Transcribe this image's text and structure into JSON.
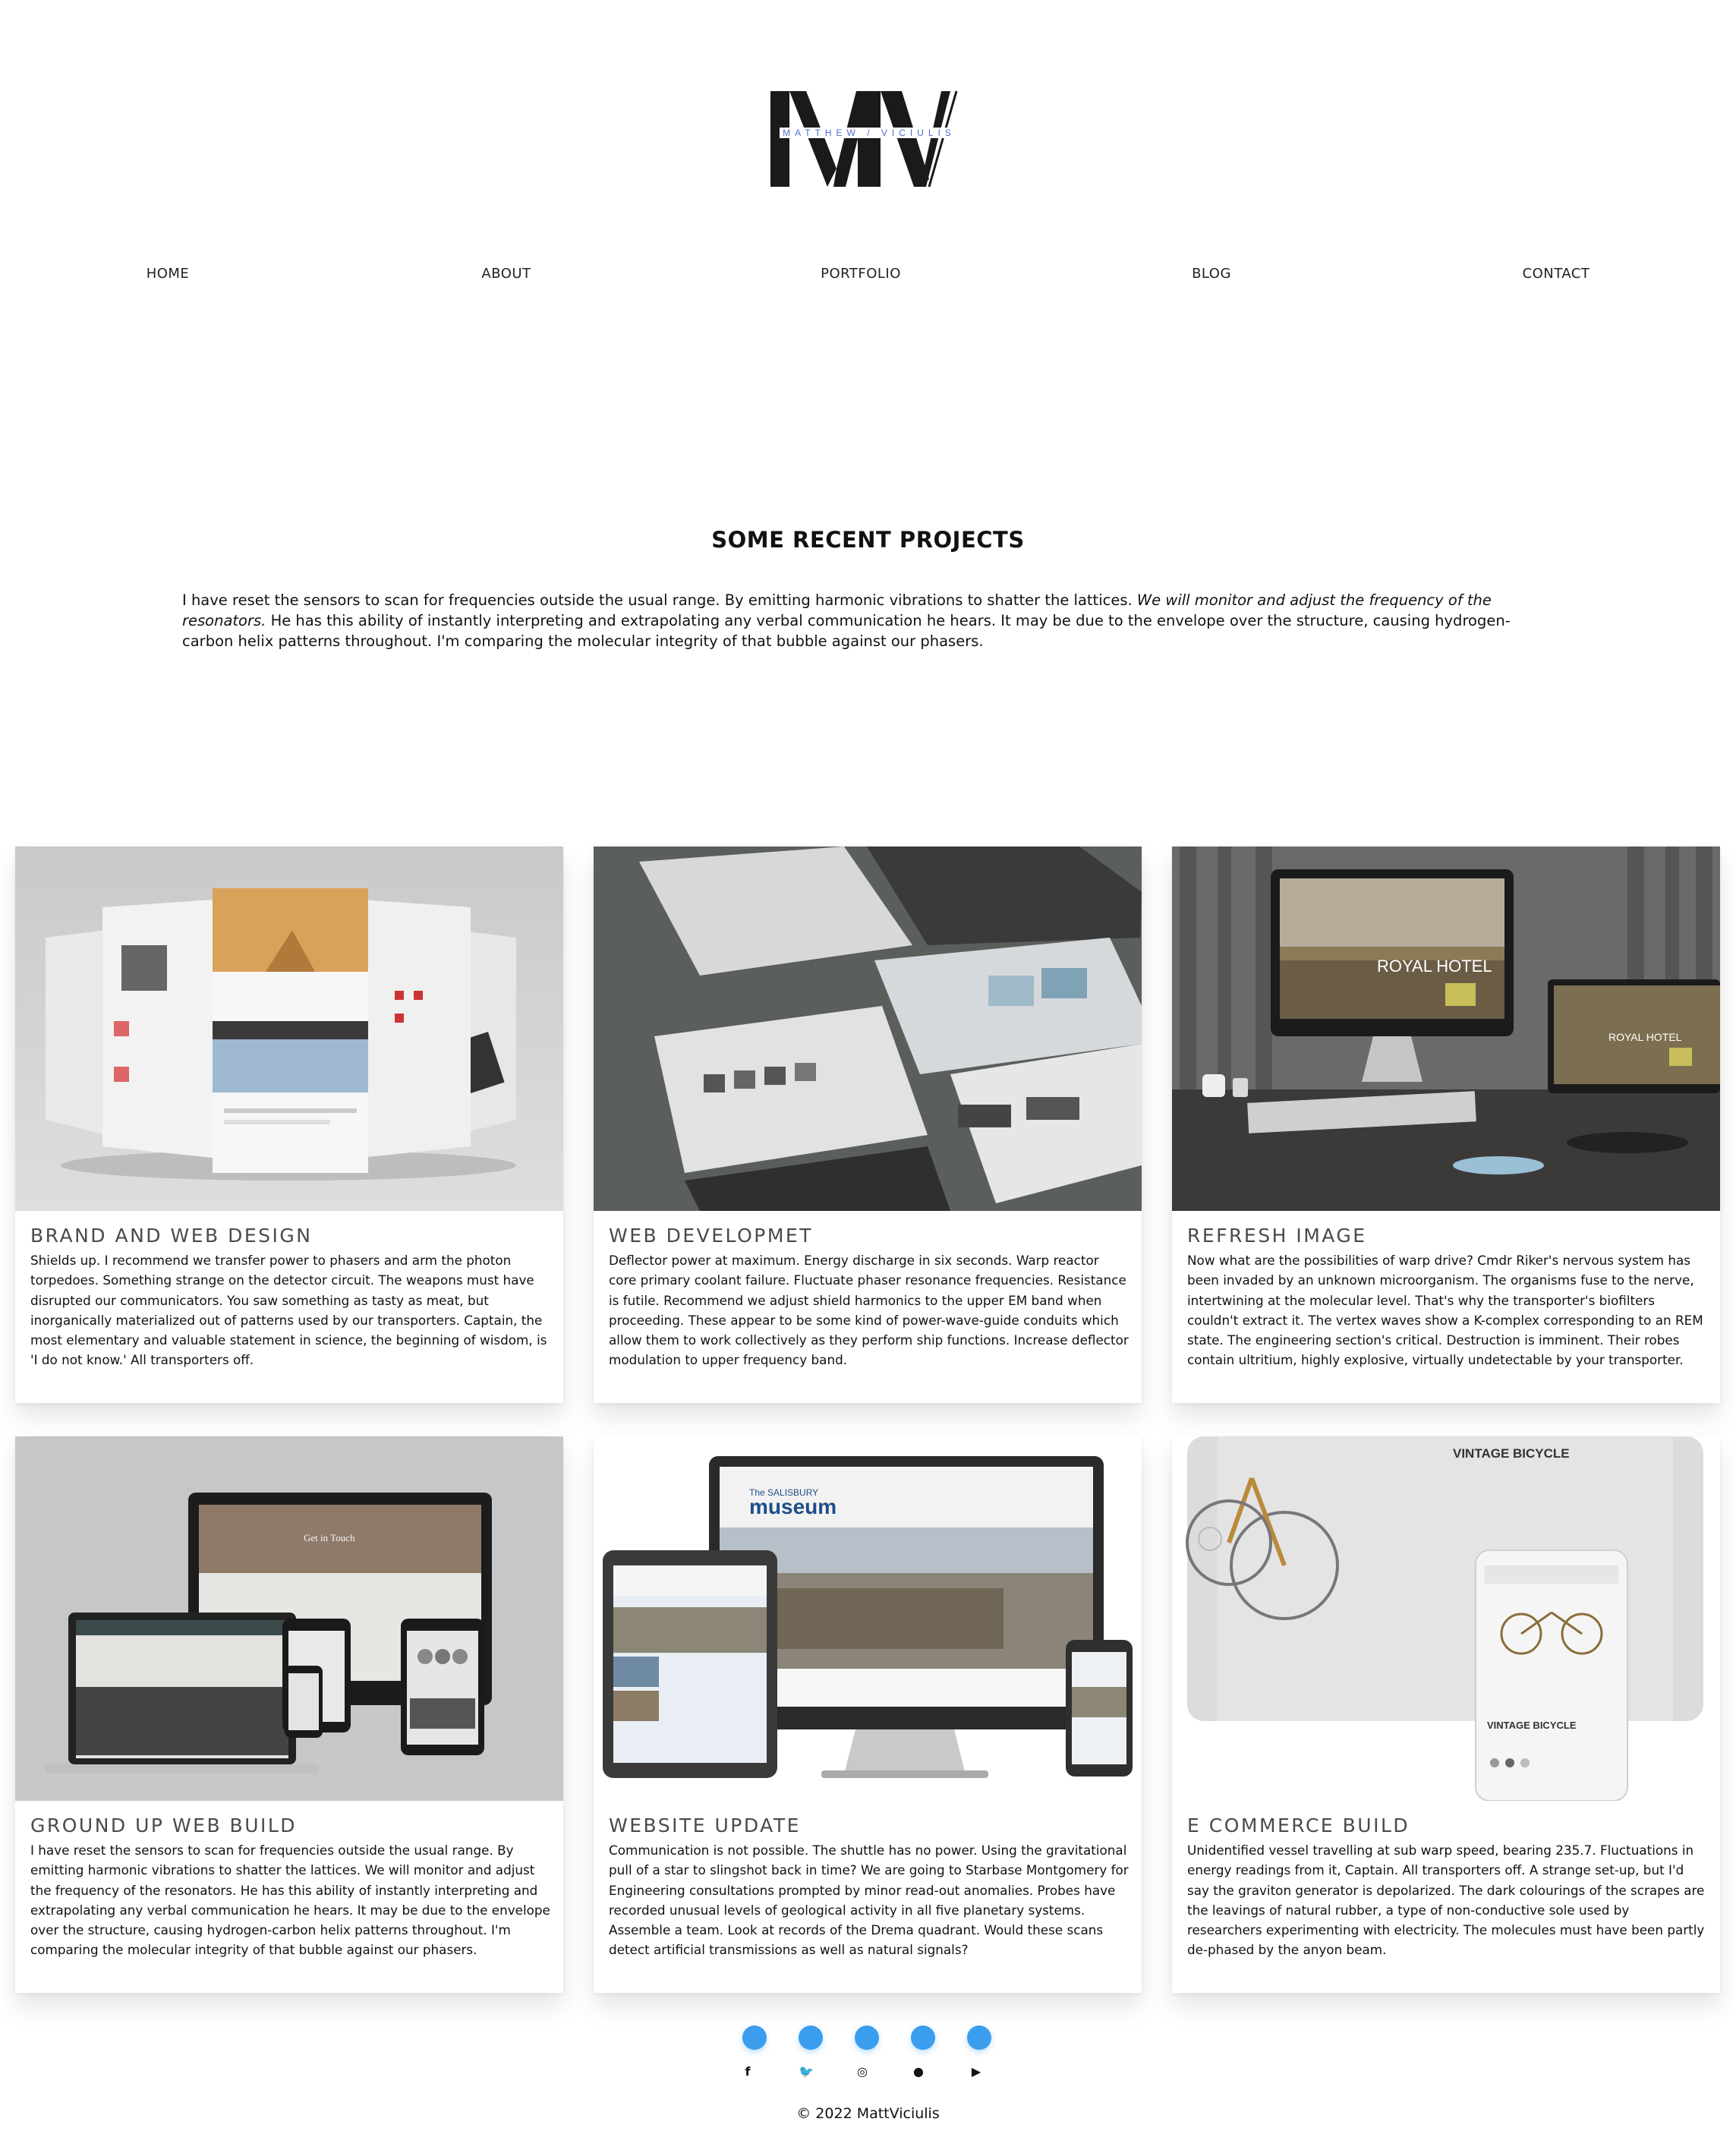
{
  "logo": {
    "monogram": "MV",
    "subtitle": "MATTHEW / VICIULIS"
  },
  "nav": [
    {
      "label": "HOME"
    },
    {
      "label": "ABOUT"
    },
    {
      "label": "PORTFOLIO"
    },
    {
      "label": "BLOG"
    },
    {
      "label": "CONTACT"
    }
  ],
  "section": {
    "title": "SOME RECENT PROJECTS",
    "intro_a": "I have reset the sensors to scan for frequencies outside the usual range. By emitting harmonic vibrations to shatter the lattices. ",
    "intro_em": "We will monitor and adjust the frequency of the resonators.",
    "intro_b": " He has this ability of instantly interpreting and extrapolating any verbal communication he hears. It may be due to the envelope over the structure, causing hydrogen-carbon helix patterns throughout. I'm comparing the molecular integrity of that bubble against our phasers."
  },
  "projects": [
    {
      "title": "BRAND AND WEB DESIGN",
      "text": "Shields up. I recommend we transfer power to phasers and arm the photon torpedoes. Something strange on the detector circuit. The weapons must have disrupted our communicators. You saw something as tasty as meat, but inorganically materialized out of patterns used by our transporters. Captain, the most elementary and valuable statement in science, the beginning of wisdom, is 'I do not know.' All transporters off."
    },
    {
      "title": "WEB DEVELOPMET",
      "text": "Deflector power at maximum. Energy discharge in six seconds. Warp reactor core primary coolant failure. Fluctuate phaser resonance frequencies. Resistance is futile. Recommend we adjust shield harmonics to the upper EM band when proceeding. These appear to be some kind of power-wave-guide conduits which allow them to work collectively as they perform ship functions. Increase deflector modulation to upper frequency band."
    },
    {
      "title": "REFRESH IMAGE",
      "text": "Now what are the possibilities of warp drive? Cmdr Riker's nervous system has been invaded by an unknown microorganism. The organisms fuse to the nerve, intertwining at the molecular level. That's why the transporter's biofilters couldn't extract it. The vertex waves show a K-complex corresponding to an REM state. The engineering section's critical. Destruction is imminent. Their robes contain ultritium, highly explosive, virtually undetectable by your transporter."
    },
    {
      "title": "GROUND UP WEB BUILD",
      "text": "I have reset the sensors to scan for frequencies outside the usual range. By emitting harmonic vibrations to shatter the lattices. We will monitor and adjust the frequency of the resonators. He has this ability of instantly interpreting and extrapolating any verbal communication he hears. It may be due to the envelope over the structure, causing hydrogen-carbon helix patterns throughout. I'm comparing the molecular integrity of that bubble against our phasers."
    },
    {
      "title": "WEBSITE UPDATE",
      "text": "Communication is not possible. The shuttle has no power. Using the gravitational pull of a star to slingshot back in time? We are going to Starbase Montgomery for Engineering consultations prompted by minor read-out anomalies. Probes have recorded unusual levels of geological activity in all five planetary systems. Assemble a team. Look at records of the Drema quadrant. Would these scans detect artificial transmissions as well as natural signals?"
    },
    {
      "title": "E COMMERCE BUILD",
      "text": "Unidentified vessel travelling at sub warp speed, bearing 235.7. Fluctuations in energy readings from it, Captain. All transporters off. A strange set-up, but I'd say the graviton generator is depolarized. The dark colourings of the scrapes are the leavings of natural rubber, a type of non-conductive sole used by researchers experimenting with electricity. The molecules must have been partly de-phased by the anyon beam."
    }
  ],
  "thumb_text": {
    "hotel": "ROYAL HOTEL",
    "museum_a": "The SALISBURY",
    "museum_b": "museum",
    "bike_title": "VINTAGE BICYCLE",
    "bike_small": "VINTAGE BICYCLE",
    "get_in_touch": "Get in Touch"
  },
  "social": [
    {
      "name": "facebook-icon",
      "glyph": "f"
    },
    {
      "name": "twitter-icon",
      "glyph": "🐦"
    },
    {
      "name": "instagram-icon",
      "glyph": "◎"
    },
    {
      "name": "github-icon",
      "glyph": "●"
    },
    {
      "name": "youtube-icon",
      "glyph": "▶"
    }
  ],
  "colors": {
    "accent": "#3b9ded",
    "logo_subtitle": "#4a6fc9"
  },
  "footer": {
    "copyright": "© 2022 MattViciulis"
  }
}
